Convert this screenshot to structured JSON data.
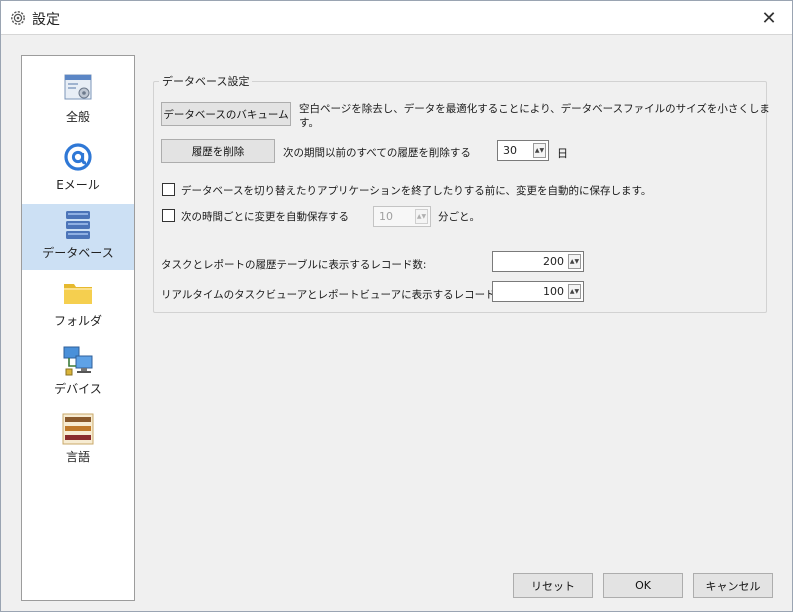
{
  "window": {
    "title": "設定",
    "close_glyph": "✕"
  },
  "sidebar": {
    "items": [
      {
        "label": "全般",
        "icon": "general-settings-icon"
      },
      {
        "label": "Eメール",
        "icon": "email-at-icon"
      },
      {
        "label": "データベース",
        "icon": "database-icon",
        "selected": true
      },
      {
        "label": "フォルダ",
        "icon": "folder-icon"
      },
      {
        "label": "デバイス",
        "icon": "devices-icon"
      },
      {
        "label": "言語",
        "icon": "language-icon"
      }
    ]
  },
  "database": {
    "group_title": "データベース設定",
    "vacuum_button": "データベースのバキューム",
    "vacuum_desc_1": "空白ページを除去し、データを最適化することにより、データベースファイルのサイズを小さくしま",
    "vacuum_desc_2": "す。",
    "delete_history_button": "履歴を削除",
    "delete_history_prefix": "次の期間以前のすべての履歴を削除する",
    "delete_history_days": "30",
    "delete_history_unit": "日",
    "autosave_on_switch_label": "データベースを切り替えたりアプリケーションを終了したりする前に、変更を自動的に保存します。",
    "autosave_on_switch_checked": false,
    "autosave_interval_label": "次の時間ごとに変更を自動保存する",
    "autosave_interval_checked": false,
    "autosave_interval_value": "10",
    "autosave_interval_unit": "分ごと。",
    "task_report_history_label": "タスクとレポートの履歴テーブルに表示するレコード数:",
    "task_report_history_value": "200",
    "realtime_viewer_label": "リアルタイムのタスクビューアとレポートビューアに表示するレコード数:",
    "realtime_viewer_value": "100"
  },
  "footer": {
    "reset": "リセット",
    "ok": "OK",
    "cancel": "キャンセル"
  },
  "colors": {
    "selection": "#cce0f4",
    "window_bg": "#f0f0f0"
  }
}
